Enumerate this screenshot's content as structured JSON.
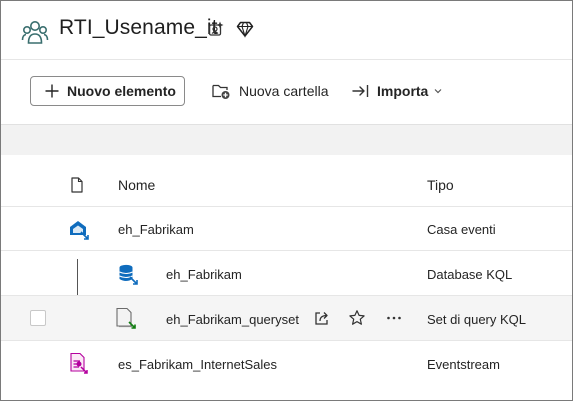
{
  "header": {
    "workspace_title": "RTI_Usename_it"
  },
  "toolbar": {
    "new_item": "Nuovo elemento",
    "new_folder": "Nuova cartella",
    "import": "Importa"
  },
  "table": {
    "columns": {
      "name": "Nome",
      "type": "Tipo"
    },
    "rows": [
      {
        "name": "eh_Fabrikam",
        "type": "Casa eventi"
      },
      {
        "name": "eh_Fabrikam",
        "type": "Database KQL"
      },
      {
        "name": "eh_Fabrikam_queryset",
        "type": "Set di query KQL"
      },
      {
        "name": "es_Fabrikam_InternetSales",
        "type": "Eventstream"
      }
    ]
  },
  "colors": {
    "accent": "#0f6cbd",
    "eventstream": "#b4009e",
    "queryset_accent": "#107c10"
  },
  "icons": [
    "workspace-icon",
    "identity-icon",
    "diamond-icon",
    "plus-icon",
    "new-folder-icon",
    "import-icon",
    "chevron-down-icon",
    "file-icon",
    "eventhouse-icon",
    "kql-database-icon",
    "kql-queryset-icon",
    "eventstream-icon",
    "share-icon",
    "star-icon",
    "more-icon"
  ]
}
